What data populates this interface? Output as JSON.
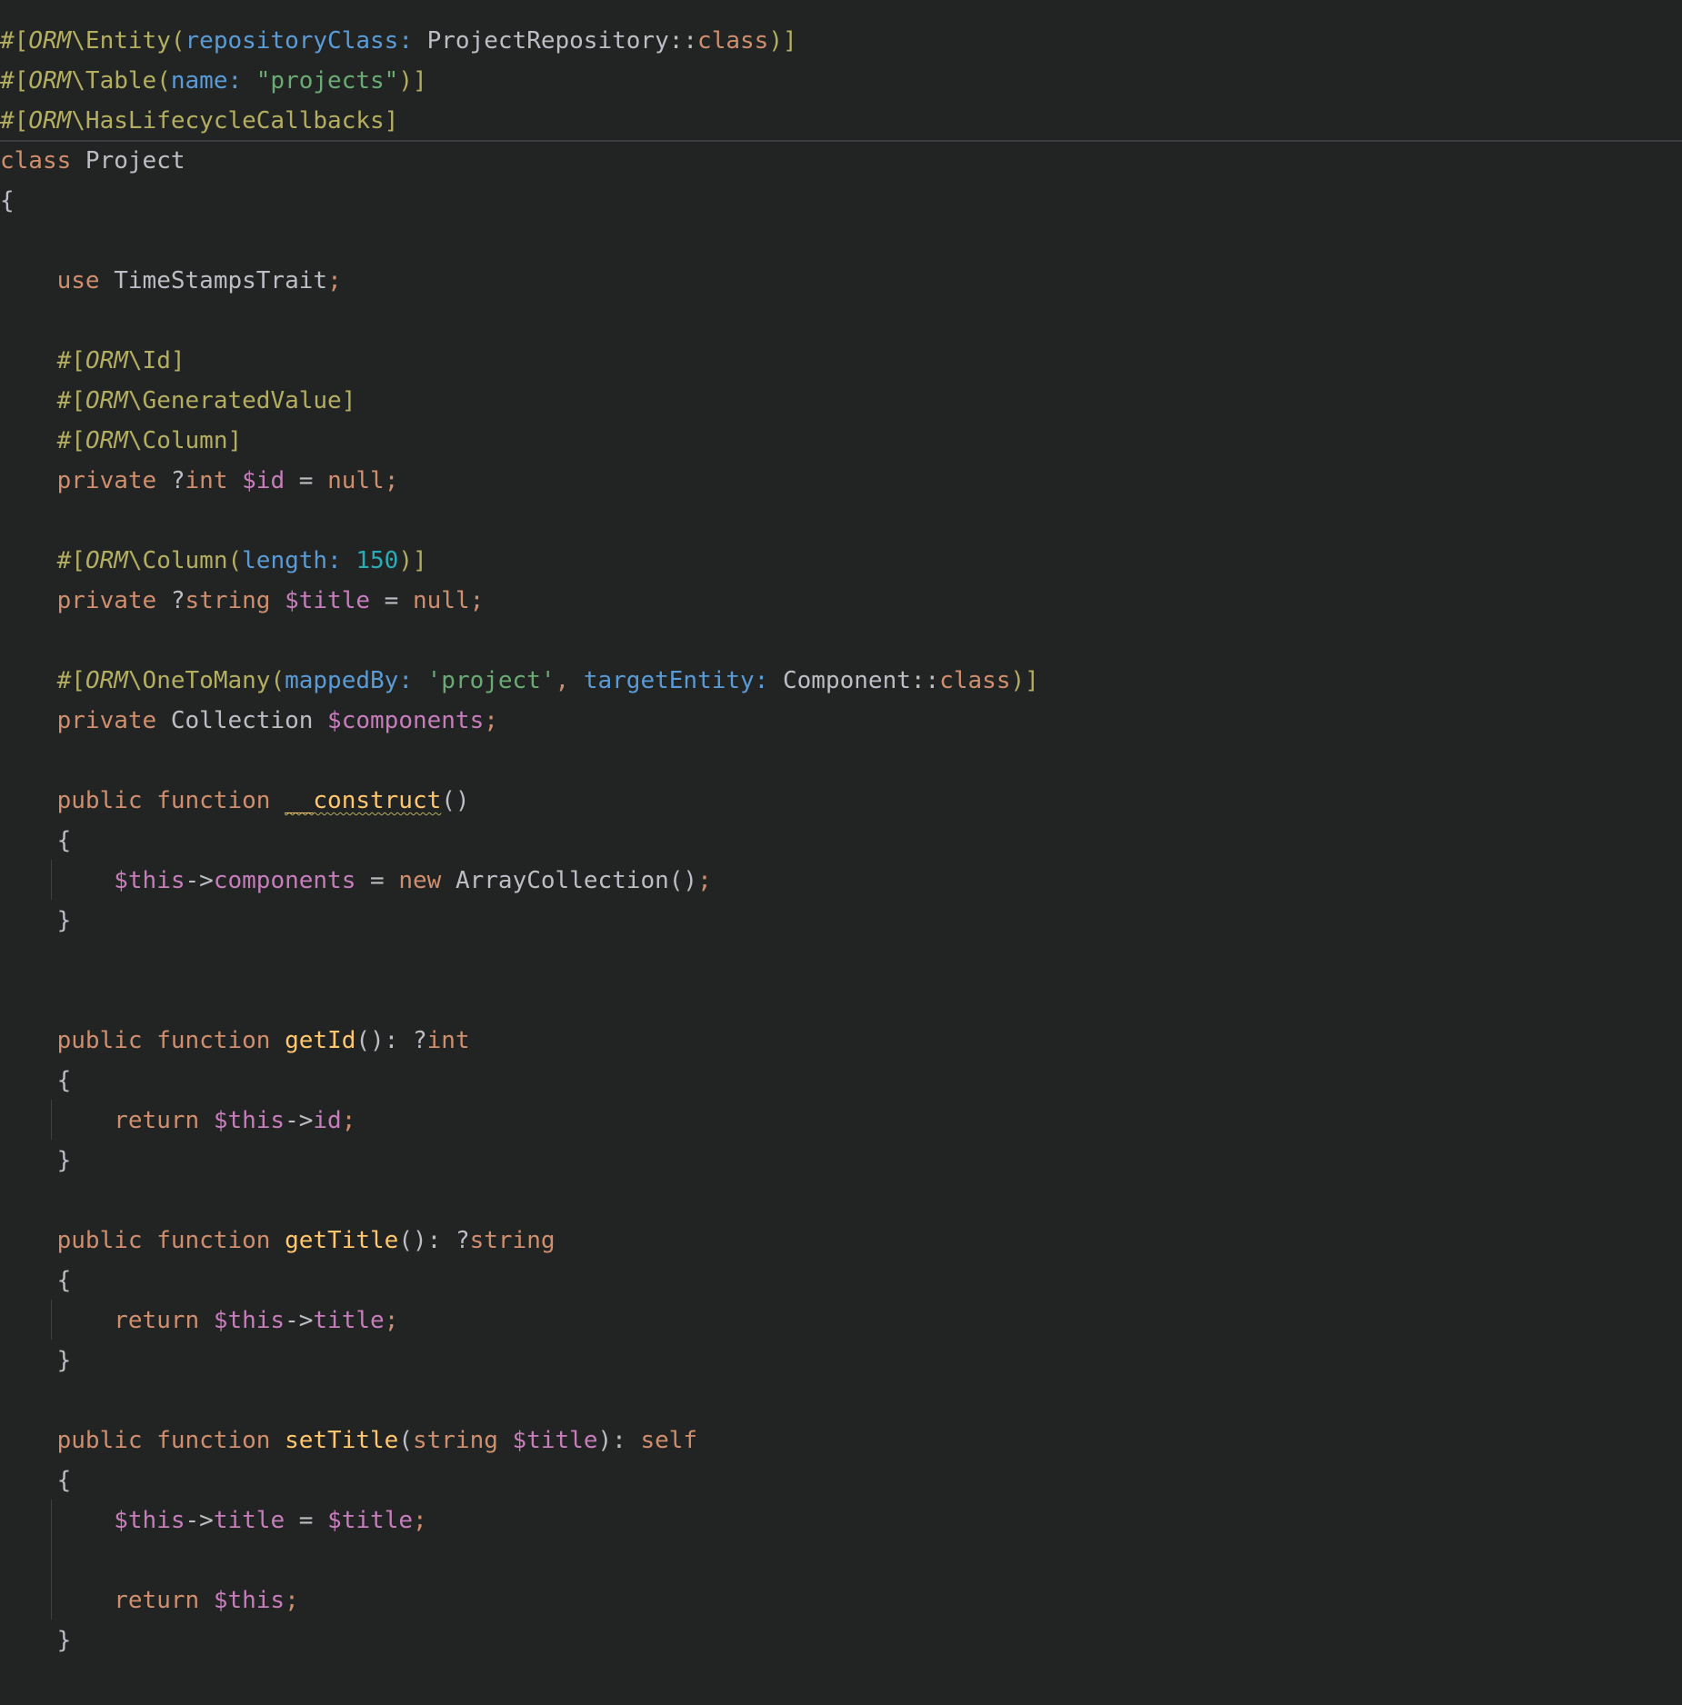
{
  "editor": {
    "language": "PHP",
    "theme": "dark",
    "colors": {
      "background": "#222424",
      "default": "#bcbec4",
      "attribute": "#b3ae60",
      "keyword": "#cf8e6d",
      "named_argument": "#5a9bd6",
      "string": "#6aab73",
      "number": "#2aacb8",
      "variable": "#c77dbb",
      "function": "#ffc66d"
    },
    "lines": [
      [
        [
          "#[",
          "attr"
        ],
        [
          "ORM",
          "orm"
        ],
        [
          "\\Entity(",
          "attr"
        ],
        [
          "repositoryClass: ",
          "param"
        ],
        [
          "ProjectRepository",
          "default"
        ],
        [
          "::",
          "default"
        ],
        [
          "class",
          "key"
        ],
        [
          ")]",
          "attr"
        ]
      ],
      [
        [
          "#[",
          "attr"
        ],
        [
          "ORM",
          "orm"
        ],
        [
          "\\Table(",
          "attr"
        ],
        [
          "name: ",
          "param"
        ],
        [
          "\"projects\"",
          "string"
        ],
        [
          ")]",
          "attr"
        ]
      ],
      [
        [
          "#[",
          "attr"
        ],
        [
          "ORM",
          "orm"
        ],
        [
          "\\HasLifecycleCallbacks]",
          "attr"
        ]
      ],
      [
        [
          "class ",
          "key"
        ],
        [
          "Project",
          "default"
        ]
      ],
      [
        [
          "{",
          "default"
        ]
      ],
      [],
      [
        [
          "    ",
          "default"
        ],
        [
          "use ",
          "key"
        ],
        [
          "TimeStampsTrait",
          "default"
        ],
        [
          ";",
          "key"
        ]
      ],
      [],
      [
        [
          "    ",
          "default"
        ],
        [
          "#[",
          "attr"
        ],
        [
          "ORM",
          "orm"
        ],
        [
          "\\Id]",
          "attr"
        ]
      ],
      [
        [
          "    ",
          "default"
        ],
        [
          "#[",
          "attr"
        ],
        [
          "ORM",
          "orm"
        ],
        [
          "\\GeneratedValue]",
          "attr"
        ]
      ],
      [
        [
          "    ",
          "default"
        ],
        [
          "#[",
          "attr"
        ],
        [
          "ORM",
          "orm"
        ],
        [
          "\\Column]",
          "attr"
        ]
      ],
      [
        [
          "    ",
          "default"
        ],
        [
          "private ",
          "key"
        ],
        [
          "?",
          "default"
        ],
        [
          "int ",
          "key"
        ],
        [
          "$id",
          "var"
        ],
        [
          " = ",
          "default"
        ],
        [
          "null",
          "key"
        ],
        [
          ";",
          "key"
        ]
      ],
      [],
      [
        [
          "    ",
          "default"
        ],
        [
          "#[",
          "attr"
        ],
        [
          "ORM",
          "orm"
        ],
        [
          "\\Column(",
          "attr"
        ],
        [
          "length: ",
          "param"
        ],
        [
          "150",
          "number"
        ],
        [
          ")]",
          "attr"
        ]
      ],
      [
        [
          "    ",
          "default"
        ],
        [
          "private ",
          "key"
        ],
        [
          "?",
          "default"
        ],
        [
          "string ",
          "key"
        ],
        [
          "$title",
          "var"
        ],
        [
          " = ",
          "default"
        ],
        [
          "null",
          "key"
        ],
        [
          ";",
          "key"
        ]
      ],
      [],
      [
        [
          "    ",
          "default"
        ],
        [
          "#[",
          "attr"
        ],
        [
          "ORM",
          "orm"
        ],
        [
          "\\OneToMany(",
          "attr"
        ],
        [
          "mappedBy: ",
          "param"
        ],
        [
          "'project'",
          "string"
        ],
        [
          ", ",
          "key"
        ],
        [
          "targetEntity: ",
          "param"
        ],
        [
          "Component",
          "default"
        ],
        [
          "::",
          "default"
        ],
        [
          "class",
          "key"
        ],
        [
          ")]",
          "attr"
        ]
      ],
      [
        [
          "    ",
          "default"
        ],
        [
          "private ",
          "key"
        ],
        [
          "Collection ",
          "default"
        ],
        [
          "$components",
          "var"
        ],
        [
          ";",
          "key"
        ]
      ],
      [],
      [
        [
          "    ",
          "default"
        ],
        [
          "public function ",
          "key"
        ],
        [
          "__construct",
          "fn-warn"
        ],
        [
          "()",
          "default"
        ]
      ],
      [
        [
          "    ",
          "default"
        ],
        [
          "{",
          "default"
        ]
      ],
      [
        [
          "        ",
          "default"
        ],
        [
          "$this",
          "var"
        ],
        [
          "->",
          "default"
        ],
        [
          "components",
          "var"
        ],
        [
          " = ",
          "default"
        ],
        [
          "new ",
          "key"
        ],
        [
          "ArrayCollection",
          "default"
        ],
        [
          "()",
          "default"
        ],
        [
          ";",
          "key"
        ]
      ],
      [
        [
          "    ",
          "default"
        ],
        [
          "}",
          "default"
        ]
      ],
      [],
      [],
      [
        [
          "    ",
          "default"
        ],
        [
          "public function ",
          "key"
        ],
        [
          "getId",
          "fn"
        ],
        [
          "(): ",
          "default"
        ],
        [
          "?",
          "default"
        ],
        [
          "int",
          "key"
        ]
      ],
      [
        [
          "    ",
          "default"
        ],
        [
          "{",
          "default"
        ]
      ],
      [
        [
          "        ",
          "default"
        ],
        [
          "return ",
          "key"
        ],
        [
          "$this",
          "var"
        ],
        [
          "->",
          "default"
        ],
        [
          "id",
          "var"
        ],
        [
          ";",
          "key"
        ]
      ],
      [
        [
          "    ",
          "default"
        ],
        [
          "}",
          "default"
        ]
      ],
      [],
      [
        [
          "    ",
          "default"
        ],
        [
          "public function ",
          "key"
        ],
        [
          "getTitle",
          "fn"
        ],
        [
          "(): ",
          "default"
        ],
        [
          "?",
          "default"
        ],
        [
          "string",
          "key"
        ]
      ],
      [
        [
          "    ",
          "default"
        ],
        [
          "{",
          "default"
        ]
      ],
      [
        [
          "        ",
          "default"
        ],
        [
          "return ",
          "key"
        ],
        [
          "$this",
          "var"
        ],
        [
          "->",
          "default"
        ],
        [
          "title",
          "var"
        ],
        [
          ";",
          "key"
        ]
      ],
      [
        [
          "    ",
          "default"
        ],
        [
          "}",
          "default"
        ]
      ],
      [],
      [
        [
          "    ",
          "default"
        ],
        [
          "public function ",
          "key"
        ],
        [
          "setTitle",
          "fn"
        ],
        [
          "(",
          "default"
        ],
        [
          "string ",
          "key"
        ],
        [
          "$title",
          "var"
        ],
        [
          "): ",
          "default"
        ],
        [
          "self",
          "key"
        ]
      ],
      [
        [
          "    ",
          "default"
        ],
        [
          "{",
          "default"
        ]
      ],
      [
        [
          "        ",
          "default"
        ],
        [
          "$this",
          "var"
        ],
        [
          "->",
          "default"
        ],
        [
          "title",
          "var"
        ],
        [
          " = ",
          "default"
        ],
        [
          "$title",
          "var"
        ],
        [
          ";",
          "key"
        ]
      ],
      [],
      [
        [
          "        ",
          "default"
        ],
        [
          "return ",
          "key"
        ],
        [
          "$this",
          "var"
        ],
        [
          ";",
          "key"
        ]
      ],
      [
        [
          "    ",
          "default"
        ],
        [
          "}",
          "default"
        ]
      ]
    ]
  }
}
